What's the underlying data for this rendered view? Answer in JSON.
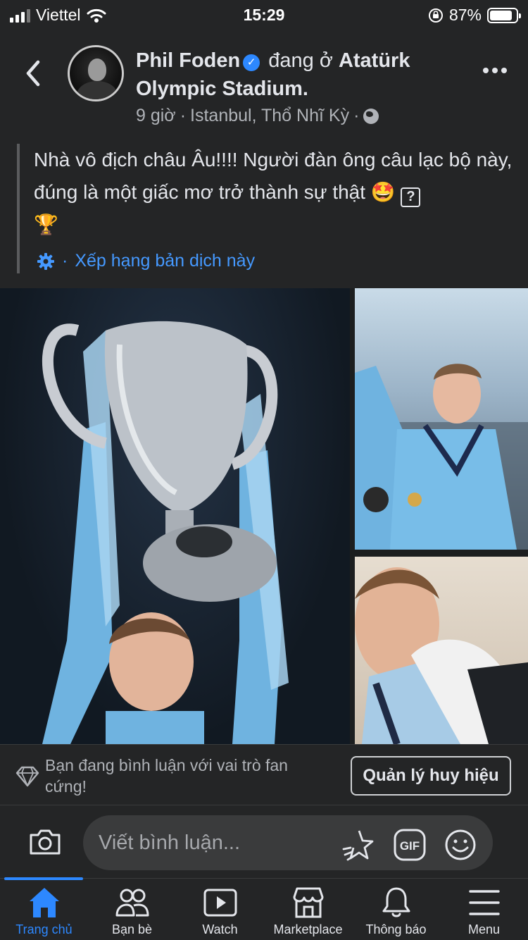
{
  "status_bar": {
    "carrier": "Viettel",
    "time": "15:29",
    "battery": "87%",
    "battery_level": 0.87
  },
  "post": {
    "author": "Phil Foden",
    "location_prefix": "đang ở",
    "location_line1": "Atatürk",
    "location_line2": "Olympic Stadium.",
    "time_ago": "9 giờ",
    "place": "Istanbul, Thổ Nhĩ Kỳ",
    "caption": "Nhà vô địch châu Âu!!!! Người đàn ông câu lạc bộ này, đúng là một giấc mơ trở thành sự thật",
    "caption_emoji": "🤩",
    "caption_unknown_glyph": "?",
    "caption_trophy": "🏆",
    "translate_label": "Xếp hạng bản dịch này"
  },
  "fan_badge": {
    "text": "Bạn đang bình luận với vai trò fan cứng!",
    "button_label": "Quản lý huy hiệu"
  },
  "composer": {
    "placeholder": "Viết bình luận..."
  },
  "tabs": [
    {
      "label": "Trang chủ",
      "icon": "home-icon",
      "active": true
    },
    {
      "label": "Bạn bè",
      "icon": "friends-icon",
      "active": false
    },
    {
      "label": "Watch",
      "icon": "watch-icon",
      "active": false
    },
    {
      "label": "Marketplace",
      "icon": "marketplace-icon",
      "active": false
    },
    {
      "label": "Thông báo",
      "icon": "bell-icon",
      "active": false
    },
    {
      "label": "Menu",
      "icon": "menu-icon",
      "active": false
    }
  ],
  "colors": {
    "background": "#242526",
    "accent": "#2d88ff",
    "link": "#4599ff",
    "text": "#e4e6eb",
    "muted": "#b0b3b8"
  }
}
